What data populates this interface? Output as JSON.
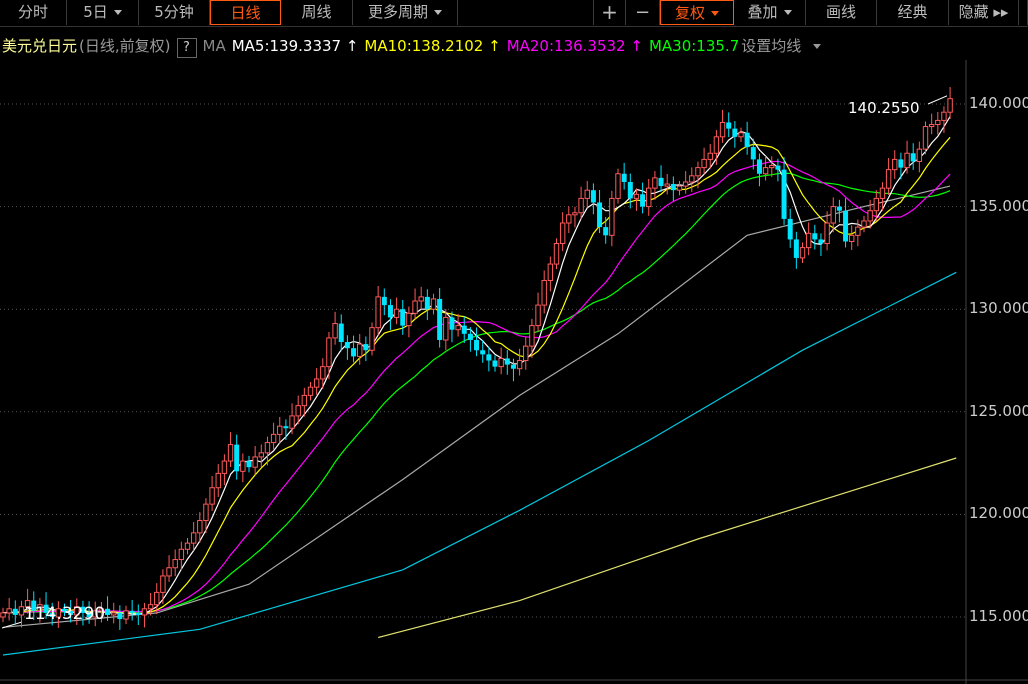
{
  "toolbar": {
    "left_tabs": [
      {
        "label": "分时"
      },
      {
        "label": "5日",
        "dropdown": true
      },
      {
        "label": "5分钟"
      },
      {
        "label": "日线",
        "active": true
      },
      {
        "label": "周线"
      },
      {
        "label": "更多周期",
        "dropdown": true
      }
    ],
    "plus": "+",
    "minus": "−",
    "right_tabs": [
      {
        "label": "复权",
        "dropdown": true,
        "active": true
      },
      {
        "label": "叠加",
        "dropdown": true
      },
      {
        "label": "画线"
      },
      {
        "label": "经典"
      },
      {
        "label": "隐藏 ▸▸"
      }
    ]
  },
  "legend": {
    "symbol": "美元兑日元",
    "mode": "(日线,前复权)",
    "help": "?",
    "ma_label": "MA",
    "ma5": "MA5:139.3337 ↑",
    "ma10": "MA10:138.2102 ↑",
    "ma20": "MA20:136.3532 ↑",
    "ma30": "MA30:135.7",
    "settings": "设置均线"
  },
  "colors": {
    "up": "#ff5a5a",
    "down": "#00e5ff",
    "ma5": "#ffffff",
    "ma10": "#ffff00",
    "ma20": "#ff00ff",
    "ma30": "#00ff00",
    "ma60": "#aaaaaa",
    "ma120": "#00c8e0",
    "ma250": "#e0e070",
    "active": "#ff5a14"
  },
  "chart_data": {
    "type": "candlestick",
    "yaxis": {
      "ticks": [
        "140.000",
        "135.000",
        "130.000",
        "125.000",
        "120.000",
        "115.000"
      ],
      "tick_values": [
        140,
        135,
        130,
        125,
        120,
        115
      ],
      "range": [
        112.4,
        143
      ]
    },
    "max_label": "140.2550",
    "min_label": "114.3290",
    "closes": [
      115.2,
      115.4,
      115.1,
      115.5,
      115.8,
      115.3,
      115.6,
      115.2,
      115.0,
      115.4,
      115.3,
      115.1,
      115.5,
      115.2,
      115.0,
      115.3,
      115.4,
      115.1,
      115.2,
      114.9,
      115.3,
      115.2,
      115.1,
      115.4,
      115.6,
      116.2,
      117.0,
      117.4,
      117.8,
      118.3,
      118.6,
      119.1,
      119.7,
      120.5,
      121.3,
      122.0,
      122.6,
      123.4,
      122.1,
      122.6,
      122.3,
      122.8,
      123.0,
      123.5,
      123.9,
      124.3,
      124.2,
      124.8,
      125.3,
      125.8,
      126.2,
      126.6,
      127.2,
      128.6,
      129.3,
      128.4,
      128.1,
      127.7,
      128.3,
      128.0,
      129.1,
      130.6,
      130.2,
      129.6,
      130.0,
      129.2,
      129.8,
      130.4,
      130.6,
      130.0,
      130.5,
      128.5,
      129.6,
      129.0,
      129.2,
      128.8,
      128.5,
      128.0,
      127.8,
      127.5,
      127.2,
      127.6,
      127.3,
      127.1,
      127.5,
      128.2,
      129.2,
      130.2,
      131.4,
      132.2,
      133.2,
      134.2,
      134.6,
      134.7,
      135.4,
      135.8,
      135.2,
      134.0,
      133.6,
      135.4,
      136.6,
      136.2,
      135.4,
      135.6,
      135.0,
      135.9,
      136.4,
      136.0,
      136.1,
      135.8,
      136.0,
      136.2,
      136.5,
      136.9,
      137.3,
      137.6,
      138.4,
      139.1,
      138.8,
      138.4,
      138.6,
      137.9,
      137.3,
      136.6,
      136.9,
      137.0,
      136.8,
      134.4,
      133.4,
      132.5,
      133.0,
      133.7,
      133.4,
      133.2,
      134.2,
      135.0,
      134.8,
      133.3,
      133.6,
      134.0,
      134.3,
      134.8,
      135.4,
      135.9,
      136.8,
      137.3,
      136.9,
      137.6,
      137.2,
      137.8,
      138.9,
      139.0,
      139.2,
      139.6,
      140.26
    ],
    "ma_long": {
      "ma60": [
        [
          0,
          114.5
        ],
        [
          25,
          115.2
        ],
        [
          40,
          116.6
        ],
        [
          65,
          121.7
        ],
        [
          84,
          125.8
        ],
        [
          100,
          128.8
        ],
        [
          121,
          133.6
        ],
        [
          140,
          135.0
        ],
        [
          154,
          136.0
        ]
      ],
      "ma120": [
        [
          0,
          113.15
        ],
        [
          32,
          114.4
        ],
        [
          65,
          117.3
        ],
        [
          84,
          120.2
        ],
        [
          105,
          123.6
        ],
        [
          130,
          128.0
        ],
        [
          155,
          131.8
        ]
      ],
      "ma250": [
        [
          61,
          114.0
        ],
        [
          84,
          115.8
        ],
        [
          113,
          118.8
        ],
        [
          155,
          122.75
        ]
      ]
    }
  }
}
